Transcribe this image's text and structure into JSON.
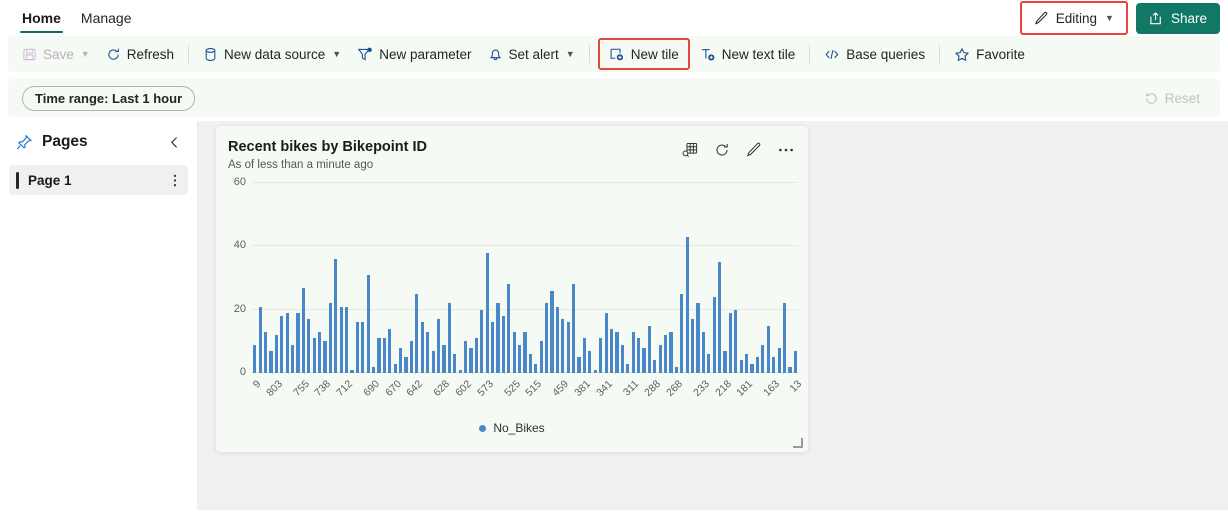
{
  "tabs": [
    {
      "label": "Home",
      "active": true
    },
    {
      "label": "Manage",
      "active": false
    }
  ],
  "header": {
    "editing_label": "Editing",
    "share_label": "Share",
    "editing_highlighted": true,
    "highlight_color": "#e8453c"
  },
  "toolbar": {
    "items": [
      {
        "label": "Save",
        "icon": "save-icon",
        "disabled": true,
        "caret": true
      },
      {
        "label": "Refresh",
        "icon": "refresh-icon",
        "disabled": false,
        "caret": false
      },
      {
        "label": "New data source",
        "icon": "database-icon",
        "disabled": false,
        "caret": true
      },
      {
        "label": "New parameter",
        "icon": "filter-add-icon",
        "disabled": false,
        "caret": false
      },
      {
        "label": "Set alert",
        "icon": "bell-icon",
        "disabled": false,
        "caret": true
      },
      {
        "label": "New tile",
        "icon": "new-tile-icon",
        "disabled": false,
        "caret": false,
        "highlighted": true
      },
      {
        "label": "New text tile",
        "icon": "new-text-tile-icon",
        "disabled": false,
        "caret": false
      },
      {
        "label": "Base queries",
        "icon": "code-icon",
        "disabled": false,
        "caret": false
      },
      {
        "label": "Favorite",
        "icon": "star-icon",
        "disabled": false,
        "caret": false
      }
    ]
  },
  "filterbar": {
    "time_range_label": "Time range: Last 1 hour",
    "reset_label": "Reset",
    "reset_disabled": true
  },
  "sidebar": {
    "title": "Pages",
    "pin_icon": "pin-icon",
    "collapse_icon": "chevron-left-icon",
    "pages": [
      {
        "label": "Page 1",
        "selected": true
      }
    ]
  },
  "tile": {
    "title": "Recent bikes by Bikepoint ID",
    "subtitle": "As of less than a minute ago",
    "actions": [
      {
        "name": "explore-data-icon",
        "label": "Explore data"
      },
      {
        "name": "refresh-icon",
        "label": "Refresh"
      },
      {
        "name": "edit-icon",
        "label": "Edit"
      },
      {
        "name": "more-icon",
        "label": "More"
      }
    ]
  },
  "chart_data": {
    "type": "bar",
    "title": "Recent bikes by Bikepoint ID",
    "xlabel": "",
    "ylabel": "",
    "ylim": [
      0,
      60
    ],
    "yticks": [
      0,
      20,
      40,
      60
    ],
    "grid": true,
    "legend_position": "bottom",
    "series": [
      {
        "name": "No_Bikes",
        "color": "#4a87c8",
        "values": [
          9,
          21,
          13,
          7,
          12,
          18,
          19,
          9,
          19,
          27,
          17,
          11,
          13,
          10,
          22,
          36,
          21,
          21,
          1,
          16,
          16,
          31,
          2,
          11,
          11,
          14,
          3,
          8,
          5,
          10,
          25,
          16,
          13,
          7,
          17,
          9,
          22,
          6,
          1,
          10,
          8,
          11,
          20,
          38,
          16,
          22,
          18,
          28,
          13,
          9,
          13,
          6,
          3,
          10,
          22,
          26,
          21,
          17,
          16,
          28,
          5,
          11,
          7,
          1,
          11,
          19,
          14,
          13,
          9,
          3,
          13,
          11,
          8,
          15,
          4,
          9,
          12,
          13,
          2,
          25,
          43,
          17,
          22,
          13,
          6,
          24,
          35,
          7,
          19,
          20,
          4,
          6,
          3,
          5,
          9,
          15,
          5,
          8,
          22,
          2,
          7
        ]
      }
    ],
    "categories": [
      "9",
      "803",
      "755",
      "738",
      "712",
      "690",
      "670",
      "642",
      "628",
      "602",
      "573",
      "525",
      "515",
      "459",
      "381",
      "341",
      "311",
      "288",
      "268",
      "233",
      "218",
      "181",
      "163",
      "13"
    ],
    "xtick_labels": [
      "9",
      "803",
      "755",
      "738",
      "712",
      "690",
      "670",
      "642",
      "628",
      "602",
      "573",
      "525",
      "515",
      "459",
      "381",
      "341",
      "311",
      "288",
      "268",
      "233",
      "218",
      "181",
      "163",
      "13"
    ],
    "legend": [
      "No_Bikes"
    ]
  }
}
